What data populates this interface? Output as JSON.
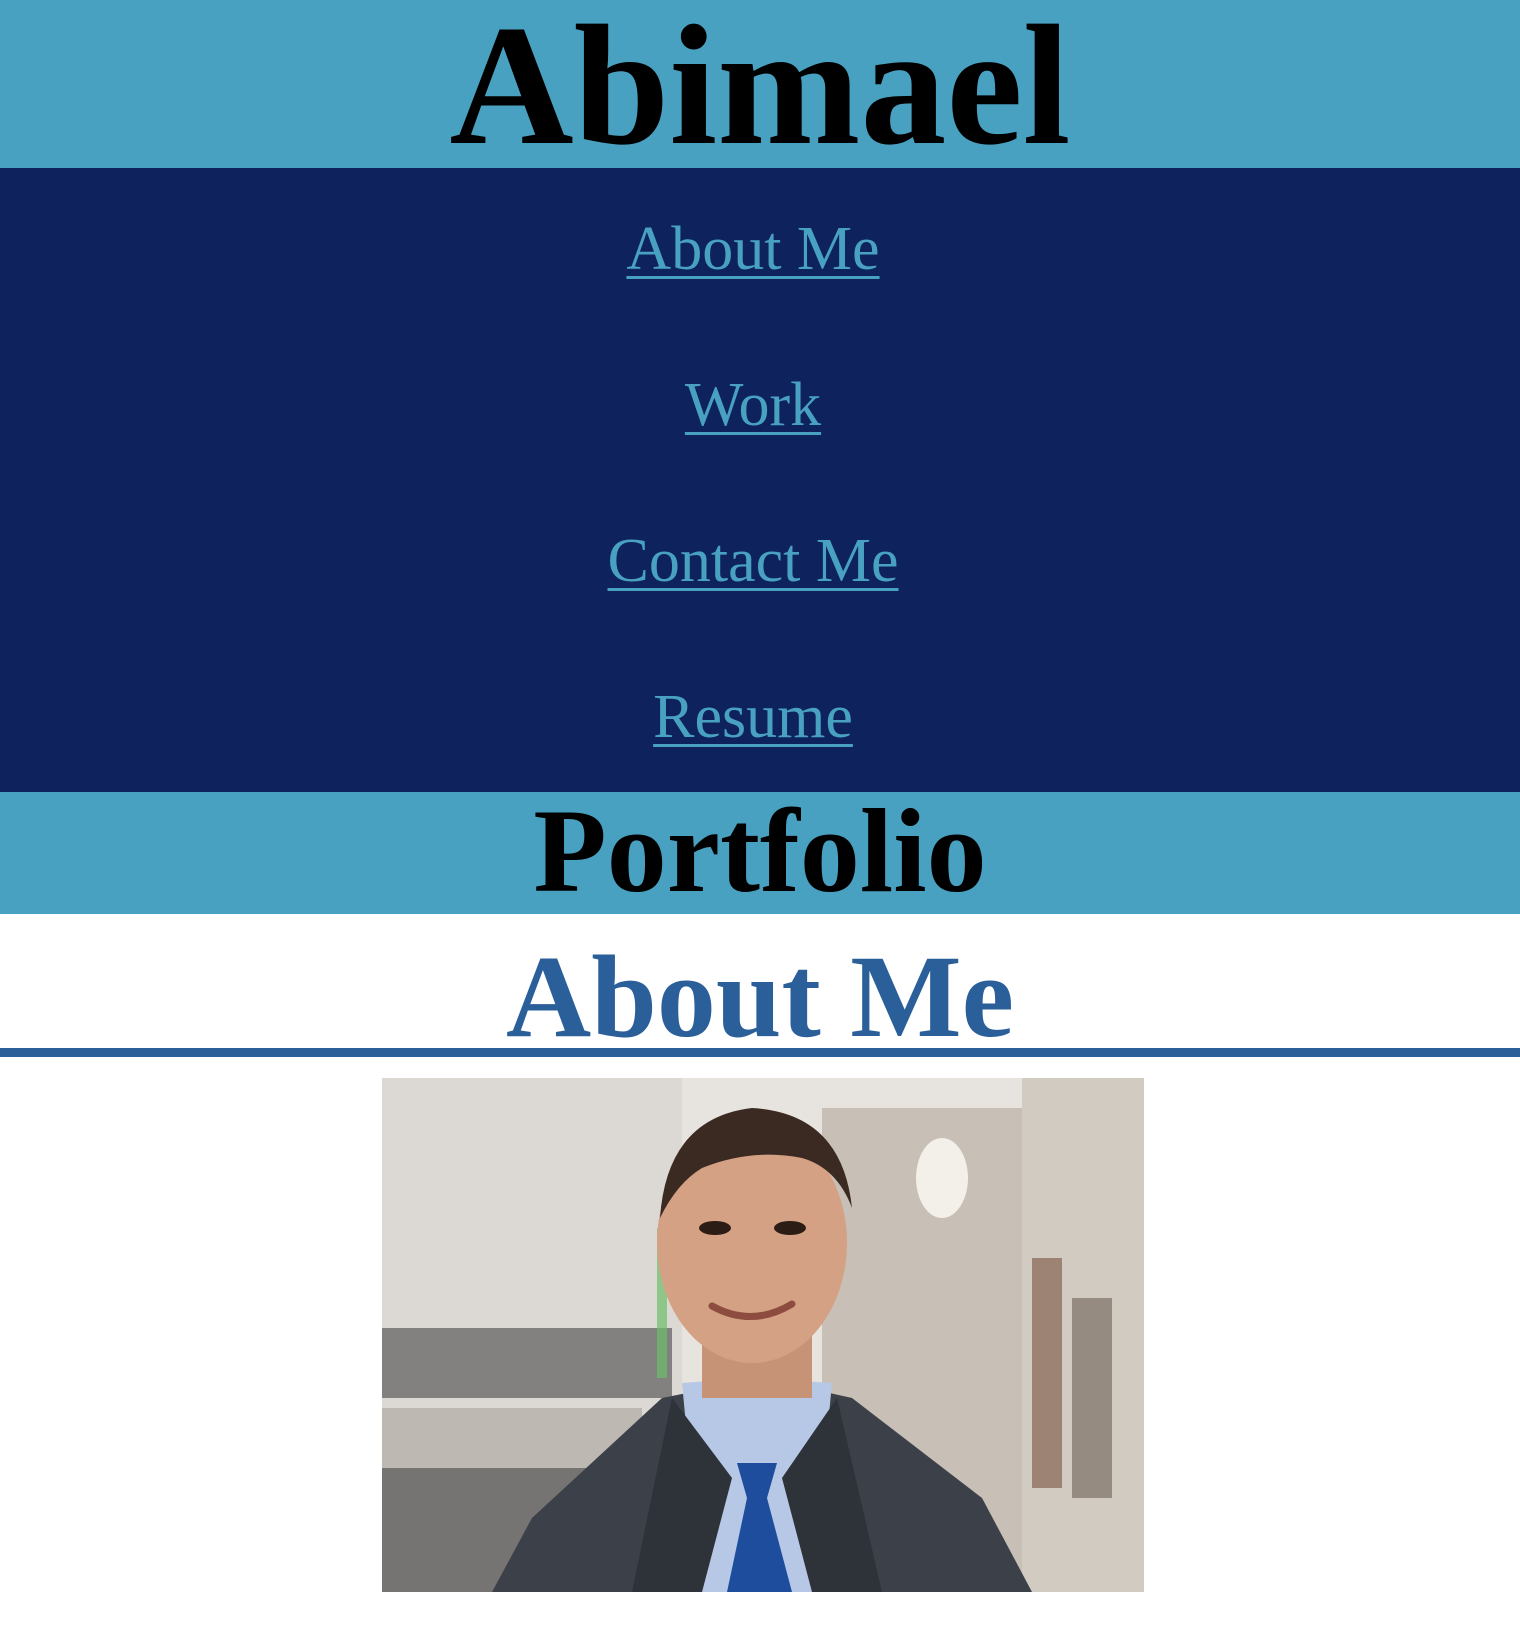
{
  "header": {
    "title": "Abimael"
  },
  "nav": {
    "items": [
      {
        "label": "About Me"
      },
      {
        "label": "Work"
      },
      {
        "label": "Contact Me"
      },
      {
        "label": "Resume"
      }
    ]
  },
  "banner": {
    "title": "Portfolio"
  },
  "about": {
    "heading": "About Me"
  },
  "colors": {
    "header_bg": "#49a1c1",
    "nav_bg": "#0e225d",
    "link": "#49a1c1",
    "accent": "#2a5f9a"
  }
}
